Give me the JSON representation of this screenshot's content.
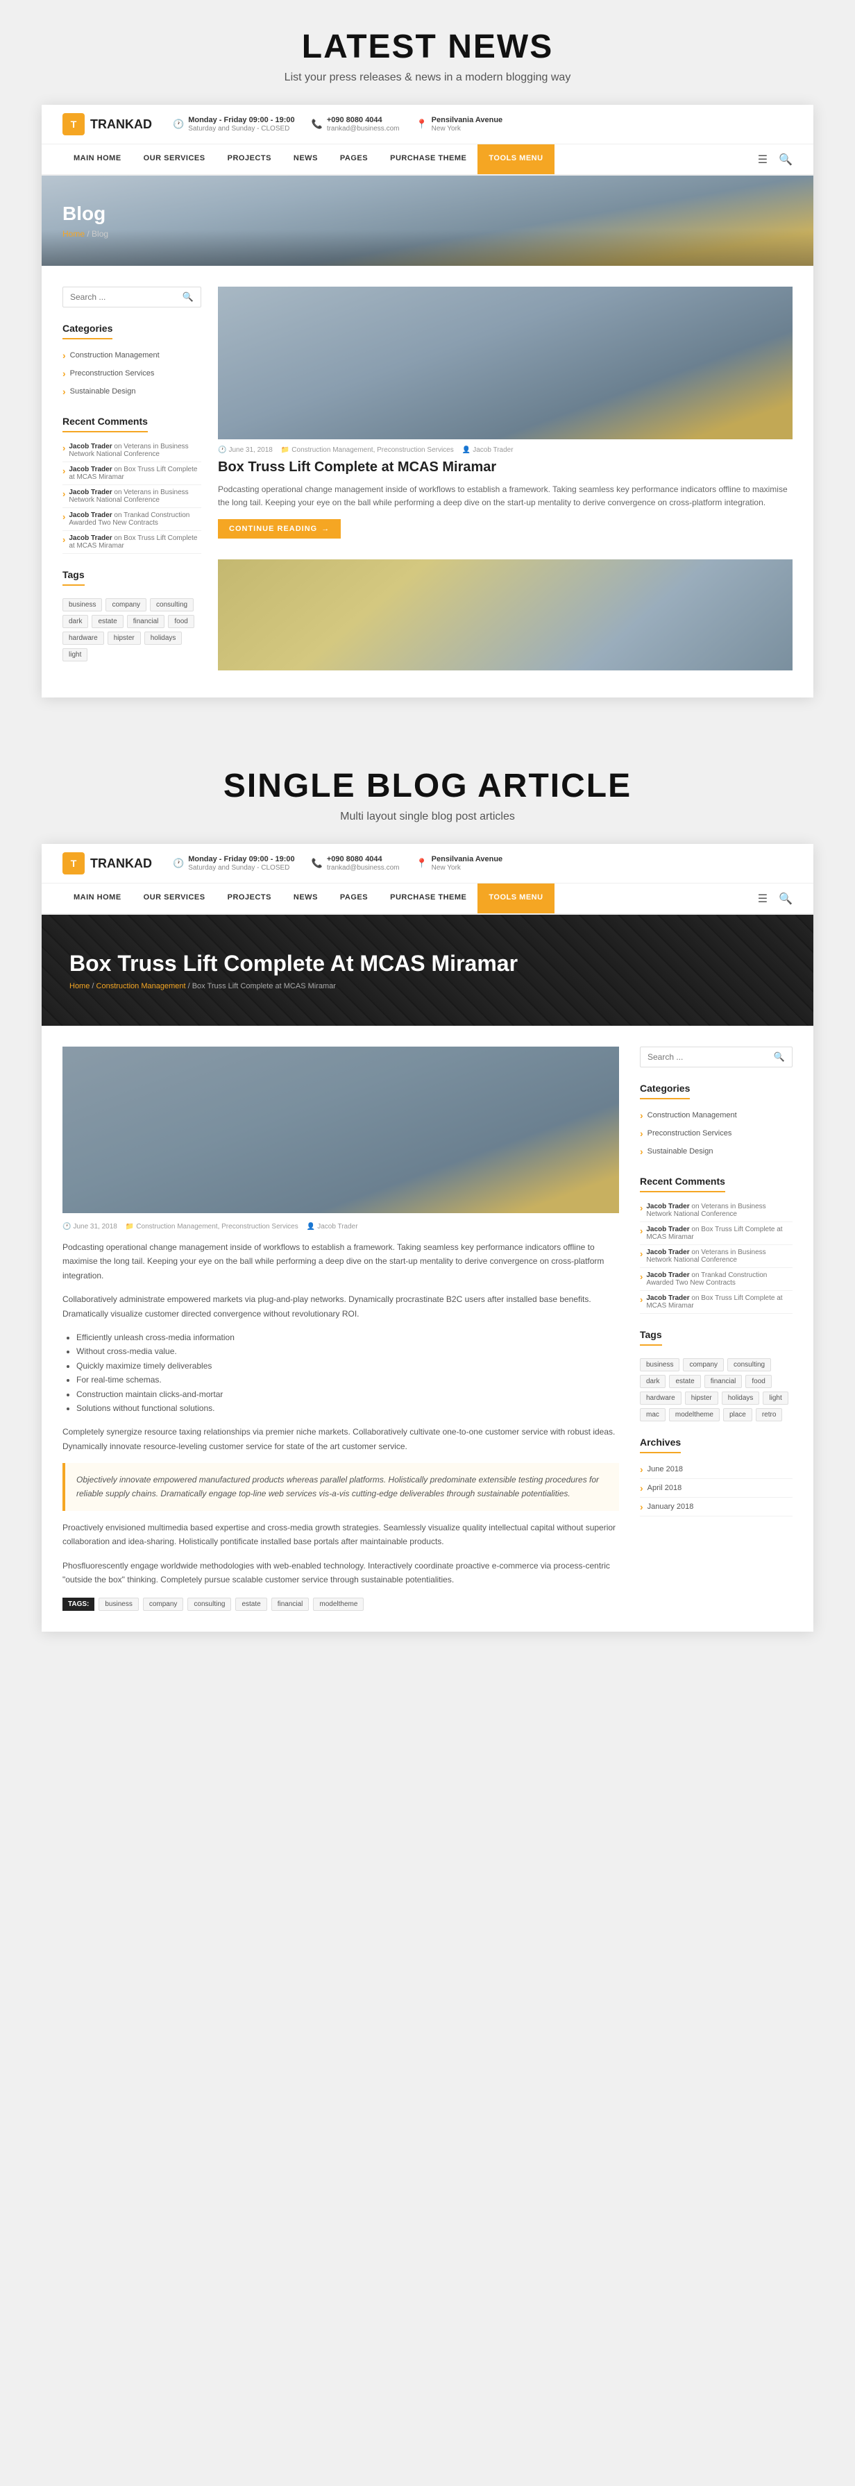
{
  "section1": {
    "title": "LATEST NEWS",
    "subtitle": "List your press releases & news in a modern blogging way"
  },
  "section2": {
    "title": "SINGLE BLOG ARTICLE",
    "subtitle": "Multi layout single blog post articles"
  },
  "navbar": {
    "logo": "TRANKAD",
    "info": [
      {
        "icon": "🕐",
        "line1": "Monday - Friday 09:00 - 19:00",
        "line2": "Saturday and Sunday - CLOSED"
      },
      {
        "icon": "📞",
        "line1": "+090 8080 4044",
        "line2": "trankad@business.com"
      },
      {
        "icon": "📍",
        "line1": "Pensilvania Avenue",
        "line2": "New York"
      }
    ],
    "nav_items": [
      {
        "label": "MAIN HOME",
        "active": false
      },
      {
        "label": "OUR SERVICES",
        "active": false
      },
      {
        "label": "PROJECTS",
        "active": false
      },
      {
        "label": "NEWS",
        "active": false
      },
      {
        "label": "PAGES",
        "active": false
      },
      {
        "label": "PURCHASE THEME",
        "active": false
      },
      {
        "label": "TOOLS MENU",
        "active": true
      }
    ]
  },
  "hero1": {
    "title": "Blog",
    "breadcrumb": "Home / Blog"
  },
  "hero2": {
    "title": "Box Truss Lift Complete At MCAS Miramar",
    "breadcrumb": "Home / Construction Management / Box Truss Lift Complete at MCAS Miramar"
  },
  "sidebar": {
    "search_placeholder": "Search ...",
    "categories_title": "Categories",
    "categories": [
      "Construction Management",
      "Preconstruction Services",
      "Sustainable Design"
    ],
    "recent_comments_title": "Recent Comments",
    "recent_comments": [
      {
        "author": "Jacob Trader",
        "on": "on Veterans in Business Network National Conference"
      },
      {
        "author": "Jacob Trader",
        "on": "on Box Truss Lift Complete at MCAS Miramar"
      },
      {
        "author": "Jacob Trader",
        "on": "on Veterans in Business Network National Conference"
      },
      {
        "author": "Jacob Trader",
        "on": "on Trankad Construction Awarded Two New Contracts"
      },
      {
        "author": "Jacob Trader",
        "on": "on Box Truss Lift Complete at MCAS Miramar"
      }
    ],
    "tags_title": "Tags",
    "tags": [
      "business",
      "company",
      "consulting",
      "dark",
      "estate",
      "financial",
      "food",
      "hardware",
      "hipster",
      "holidays",
      "light"
    ]
  },
  "article_sidebar": {
    "search_placeholder": "Search ...",
    "categories_title": "Categories",
    "categories": [
      "Construction Management",
      "Preconstruction Services",
      "Sustainable Design"
    ],
    "recent_comments_title": "Recent Comments",
    "recent_comments": [
      {
        "author": "Jacob Trader",
        "on": "on Veterans in Business Network National Conference"
      },
      {
        "author": "Jacob Trader",
        "on": "on Box Truss Lift Complete at MCAS Miramar"
      },
      {
        "author": "Jacob Trader",
        "on": "on Veterans in Business Network National Conference"
      },
      {
        "author": "Jacob Trader",
        "on": "on Trankad Construction Awarded Two New Contracts"
      },
      {
        "author": "Jacob Trader",
        "on": "on Box Truss Lift Complete at MCAS Miramar"
      }
    ],
    "tags_title": "Tags",
    "tags": [
      "business",
      "company",
      "consulting",
      "dark",
      "estate",
      "financial",
      "food",
      "hardware",
      "hipster",
      "holidays",
      "light",
      "mac",
      "modeltheme",
      "place",
      "retro"
    ],
    "archives_title": "Archives",
    "archives": [
      "June 2018",
      "April 2018",
      "January 2018"
    ]
  },
  "blog_post": {
    "date": "June 31, 2018",
    "categories": "Construction Management, Preconstruction Services",
    "author": "Jacob Trader",
    "title": "Box Truss Lift Complete at MCAS Miramar",
    "excerpt": "Podcasting operational change management inside of workflows to establish a framework. Taking seamless key performance indicators offline to maximise the long tail. Keeping your eye on the ball while performing a deep dive on the start-up mentality to derive convergence on cross-platform integration.",
    "continue_btn": "CONTINUE READING"
  },
  "article": {
    "date": "June 31, 2018",
    "categories": "Construction Management, Preconstruction Services",
    "author": "Jacob Trader",
    "body_p1": "Podcasting operational change management inside of workflows to establish a framework. Taking seamless key performance indicators offline to maximise the long tail. Keeping your eye on the ball while performing a deep dive on the start-up mentality to derive convergence on cross-platform integration.",
    "body_p2": "Collaboratively administrate empowered markets via plug-and-play networks. Dynamically procrastinate B2C users after installed base benefits. Dramatically visualize customer directed convergence without revolutionary ROI.",
    "bullet_items": [
      "Efficiently unleash cross-media information",
      "Without cross-media value.",
      "Quickly maximize timely deliverables",
      "For real-time schemas.",
      "Construction maintain clicks-and-mortar",
      "Solutions without functional solutions."
    ],
    "body_p3": "Completely synergize resource taxing relationships via premier niche markets. Collaboratively cultivate one-to-one customer service with robust ideas. Dynamically innovate resource-leveling customer service for state of the art customer service.",
    "blockquote": "Objectively innovate empowered manufactured products whereas parallel platforms. Holistically predominate extensible testing procedures for reliable supply chains. Dramatically engage top-line web services vis-a-vis cutting-edge deliverables through sustainable potentialities.",
    "body_p4": "Proactively envisioned multimedia based expertise and cross-media growth strategies. Seamlessly visualize quality intellectual capital without superior collaboration and idea-sharing. Holistically pontificate installed base portals after maintainable products.",
    "body_p5": "Phosfluorescently engage worldwide methodologies with web-enabled technology. Interactively coordinate proactive e-commerce via process-centric \"outside the box\" thinking. Completely pursue scalable customer service through sustainable potentialities.",
    "tags_label": "Tags:",
    "tags": [
      "business",
      "company",
      "consulting",
      "estate",
      "financial",
      "modeltheme"
    ]
  }
}
